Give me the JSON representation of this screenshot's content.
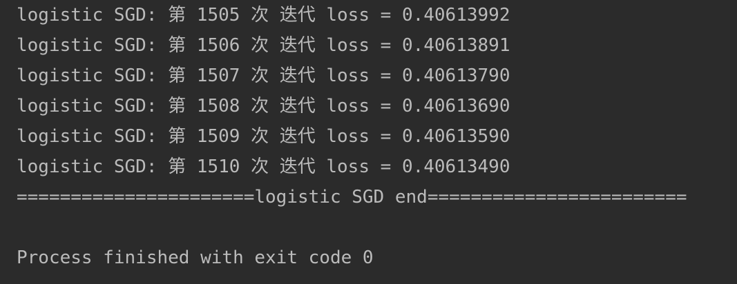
{
  "console": {
    "lines": [
      "logistic SGD: 第 1505 次 迭代 loss = 0.40613992",
      "logistic SGD: 第 1506 次 迭代 loss = 0.40613891",
      "logistic SGD: 第 1507 次 迭代 loss = 0.40613790",
      "logistic SGD: 第 1508 次 迭代 loss = 0.40613690",
      "logistic SGD: 第 1509 次 迭代 loss = 0.40613590",
      "logistic SGD: 第 1510 次 迭代 loss = 0.40613490",
      "======================logistic SGD end========================",
      "",
      "Process finished with exit code 0"
    ],
    "colors": {
      "background": "#2b2b2b",
      "text": "#bbbbbb"
    }
  }
}
